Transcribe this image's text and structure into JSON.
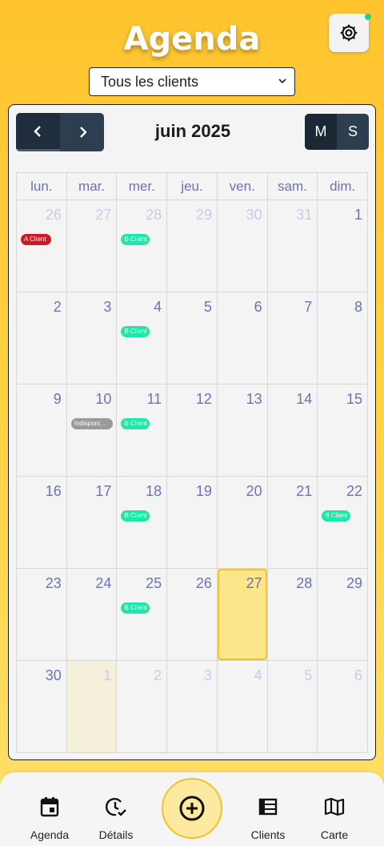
{
  "app": {
    "title": "Agenda"
  },
  "filter": {
    "selected": "Tous les clients"
  },
  "calendar": {
    "month_label": "juin 2025",
    "view_buttons": [
      "M",
      "S"
    ],
    "weekdays": [
      "lun.",
      "mar.",
      "mer.",
      "jeu.",
      "ven.",
      "sam.",
      "dim."
    ],
    "weeks": [
      [
        {
          "day": "26",
          "other": true,
          "event": {
            "label": "A Client",
            "kind": "red"
          }
        },
        {
          "day": "27",
          "other": true
        },
        {
          "day": "28",
          "other": true,
          "event": {
            "label": "B Client",
            "kind": "green"
          }
        },
        {
          "day": "29",
          "other": true
        },
        {
          "day": "30",
          "other": true
        },
        {
          "day": "31",
          "other": true
        },
        {
          "day": "1"
        }
      ],
      [
        {
          "day": "2"
        },
        {
          "day": "3"
        },
        {
          "day": "4",
          "event": {
            "label": "B Client",
            "kind": "green"
          }
        },
        {
          "day": "5"
        },
        {
          "day": "6"
        },
        {
          "day": "7"
        },
        {
          "day": "8"
        }
      ],
      [
        {
          "day": "9"
        },
        {
          "day": "10",
          "event": {
            "label": "Indisponi...",
            "kind": "gray"
          }
        },
        {
          "day": "11",
          "event": {
            "label": "B Client",
            "kind": "green"
          }
        },
        {
          "day": "12"
        },
        {
          "day": "13"
        },
        {
          "day": "14"
        },
        {
          "day": "15"
        }
      ],
      [
        {
          "day": "16"
        },
        {
          "day": "17"
        },
        {
          "day": "18",
          "event": {
            "label": "B Client",
            "kind": "green"
          }
        },
        {
          "day": "19"
        },
        {
          "day": "20"
        },
        {
          "day": "21"
        },
        {
          "day": "22",
          "event": {
            "label": "B Client",
            "kind": "green"
          }
        }
      ],
      [
        {
          "day": "23"
        },
        {
          "day": "24"
        },
        {
          "day": "25",
          "event": {
            "label": "B Client",
            "kind": "green"
          }
        },
        {
          "day": "26"
        },
        {
          "day": "27",
          "today": true
        },
        {
          "day": "28"
        },
        {
          "day": "29"
        }
      ],
      [
        {
          "day": "30"
        },
        {
          "day": "1",
          "other": true,
          "faded": true
        },
        {
          "day": "2",
          "other": true
        },
        {
          "day": "3",
          "other": true
        },
        {
          "day": "4",
          "other": true
        },
        {
          "day": "5",
          "other": true
        },
        {
          "day": "6",
          "other": true
        }
      ]
    ]
  },
  "bottom_nav": {
    "agenda": "Agenda",
    "details": "Détails",
    "clients": "Clients",
    "map": "Carte"
  },
  "colors": {
    "accent": "#ffc42e",
    "nav_dark": "#2c3e50",
    "day_number": "#6a73b8",
    "event_red": "#cf1a24",
    "event_green": "#1ee8a8",
    "event_gray": "#9a9a9a",
    "today": "#fde58a"
  }
}
